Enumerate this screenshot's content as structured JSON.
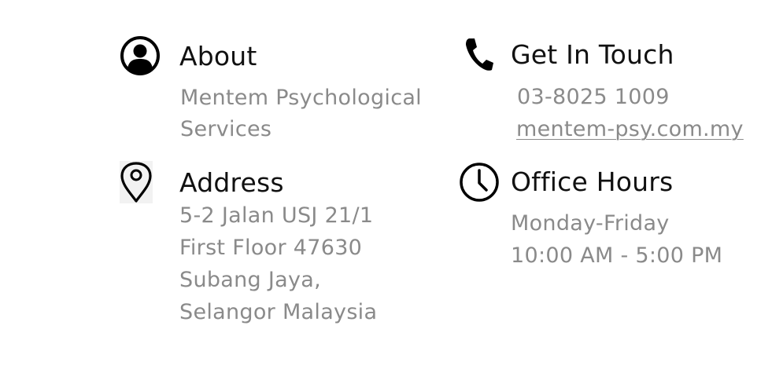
{
  "about": {
    "icon": "user-circle-icon",
    "heading": "About",
    "lines": [
      "Mentem Psychological",
      "Services"
    ]
  },
  "contact": {
    "icon": "phone-icon",
    "heading": "Get In Touch",
    "phone": "03-8025 1009",
    "website": "mentem-psy.com.my"
  },
  "address": {
    "icon": "map-pin-icon",
    "heading": "Address",
    "lines": [
      "5-2 Jalan USJ 21/1",
      "First Floor 47630",
      "Subang Jaya,",
      "Selangor Malaysia"
    ]
  },
  "hours": {
    "icon": "clock-icon",
    "heading": "Office Hours",
    "lines": [
      "Monday-Friday",
      "10:00 AM - 5:00 PM"
    ]
  },
  "colors": {
    "heading": "#111111",
    "body_text": "#8a8a8a"
  }
}
